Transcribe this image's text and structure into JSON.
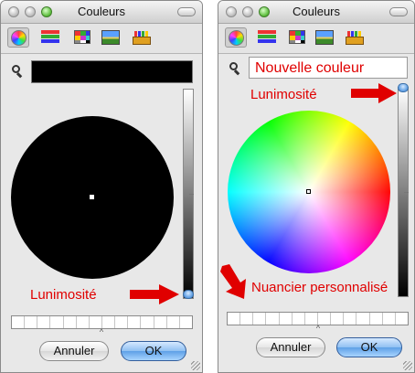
{
  "windows": [
    {
      "id": "left",
      "title": "Couleurs",
      "name_field_value": "",
      "current_color": "#000000",
      "brightness_fraction": 0.0,
      "annotations": [
        {
          "text": "Lunimosité",
          "color": "#e00000"
        }
      ],
      "buttons": {
        "cancel": "Annuler",
        "ok": "OK"
      }
    },
    {
      "id": "right",
      "title": "Couleurs",
      "name_field_value": "Nouvelle couleur",
      "current_color": "#ffffff",
      "brightness_fraction": 1.0,
      "annotations": [
        {
          "text": "Lunimosité",
          "color": "#e00000"
        },
        {
          "text": "Nuancier personnalisé",
          "color": "#e00000"
        }
      ],
      "buttons": {
        "cancel": "Annuler",
        "ok": "OK"
      }
    }
  ],
  "toolbar_icons": [
    "color-wheel-icon",
    "color-sliders-icon",
    "color-palettes-icon",
    "image-palettes-icon",
    "crayons-icon"
  ],
  "custom_swatch_slots": 14,
  "colors": {
    "annotation_red": "#e00000",
    "ok_button_blue": "#5d9fe6"
  }
}
